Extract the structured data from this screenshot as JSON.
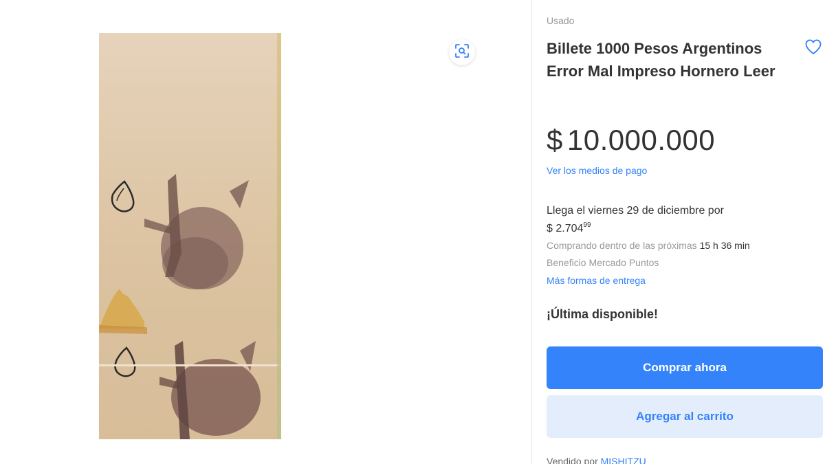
{
  "product": {
    "condition": "Usado",
    "title": "Billete 1000 Pesos Argentinos Error Mal Impreso Hornero Leer",
    "price_symbol": "$",
    "price_amount": "10.000.000",
    "payment_link": "Ver los medios de pago"
  },
  "shipping": {
    "arrival": "Llega el viernes 29 de diciembre por",
    "cost_main": "$ 2.704",
    "cost_cents": "99",
    "timer_prefix": "Comprando dentro de las próximas",
    "timer_value": "15 h 36 min",
    "benefit": "Beneficio Mercado Puntos",
    "more_link": "Más formas de entrega"
  },
  "stock_text": "¡Última disponible!",
  "actions": {
    "buy_now": "Comprar ahora",
    "add_to_cart": "Agregar al carrito"
  },
  "seller": {
    "prefix": "Vendido por",
    "name": "MISHITZU"
  },
  "icons": {
    "zoom": "zoom-scan-icon",
    "favorite": "heart-icon"
  },
  "colors": {
    "accent": "#3483fa",
    "accent_light": "#e3edfb"
  }
}
